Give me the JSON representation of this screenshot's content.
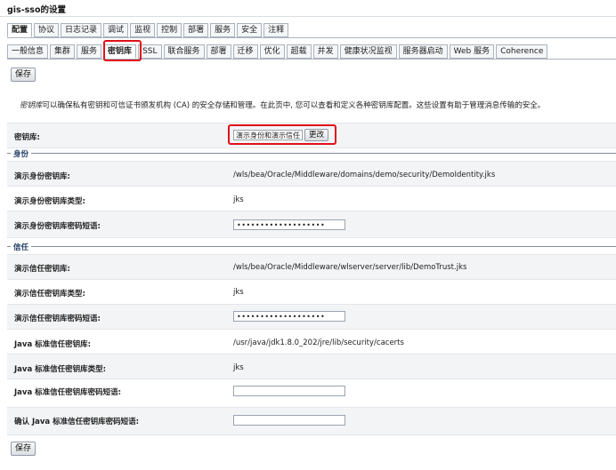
{
  "window": {
    "title": "gis-sso的设置"
  },
  "main_tabs": [
    "配置",
    "协议",
    "日志记录",
    "调试",
    "监视",
    "控制",
    "部署",
    "服务",
    "安全",
    "注释"
  ],
  "sub_tabs": [
    "一般信息",
    "集群",
    "服务",
    "密钥库",
    "SSL",
    "联合服务",
    "部署",
    "迁移",
    "优化",
    "超载",
    "并发",
    "健康状况监视",
    "服务器启动",
    "Web 服务",
    "Coherence"
  ],
  "active_main_tab": "配置",
  "active_sub_tab": "密钥库",
  "buttons": {
    "save_top": "保存",
    "save_bottom": "保存",
    "change": "更改"
  },
  "description": {
    "em": "密钥库",
    "text": "可以确保私有密钥和可信证书颁发机构 (CA) 的安全存储和管理。在此页中, 您可以查看和定义各种密钥库配置。这些设置有助于管理消息传输的安全。"
  },
  "keystores": {
    "label": "密钥库:",
    "value": "演示身份和演示信任"
  },
  "identity_section": {
    "title": "身份",
    "keystore_label": "演示身份密钥库:",
    "keystore_value": "/wls/bea/Oracle/Middleware/domains/demo/security/DemoIdentity.jks",
    "type_label": "演示身份密钥库类型:",
    "type_value": "jks",
    "pass_label": "演示身份密钥库密码短语:",
    "pass_value": "•••••••••••••••••••"
  },
  "trust_section": {
    "title": "信任",
    "keystore_label": "演示信任密钥库:",
    "keystore_value": "/wls/bea/Oracle/Middleware/wlserver/server/lib/DemoTrust.jks",
    "type_label": "演示信任密钥库类型:",
    "type_value": "jks",
    "pass_label": "演示信任密钥库密码短语:",
    "pass_value": "•••••••••••••••••••",
    "java_keystore_label": "Java 标准信任密钥库:",
    "java_keystore_value": "/usr/java/jdk1.8.0_202/jre/lib/security/cacerts",
    "java_type_label": "Java 标准信任密钥库类型:",
    "java_type_value": "jks",
    "java_pass_label": "Java 标准信任密钥库密码短语:",
    "java_pass_value": "",
    "java_confirm_label": "确认 Java 标准信任密钥库密码短语:",
    "java_confirm_value": ""
  },
  "colors": {
    "highlight": "#e0101a",
    "section_title": "#1d3a63"
  }
}
